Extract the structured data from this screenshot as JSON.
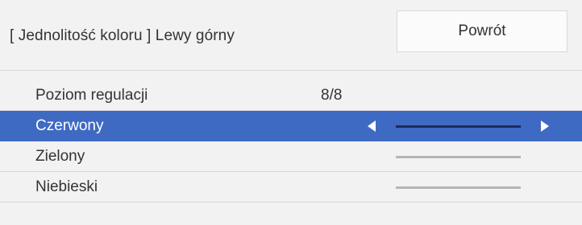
{
  "header": {
    "title": "[ Jednolitość koloru ] Lewy górny",
    "back_button": "Powrót"
  },
  "rows": [
    {
      "label": "Poziom regulacji",
      "value": "8/8"
    },
    {
      "label": "Czerwony",
      "slider_level": 0.5,
      "selected": true
    },
    {
      "label": "Zielony",
      "slider_level": 0.5
    },
    {
      "label": "Niebieski",
      "slider_level": 0.5
    }
  ],
  "colors": {
    "background": "#f2f2f2",
    "selection": "#3f6ac4",
    "text": "#333333"
  }
}
